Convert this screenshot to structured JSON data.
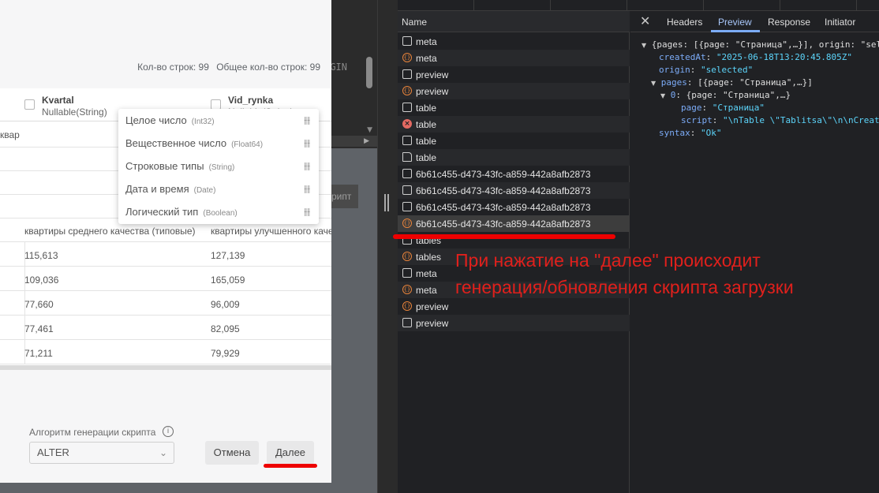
{
  "dialog": {
    "row_count_label": "Кол-во строк: 99",
    "total_row_count_label": "Общее кол-во строк: 99",
    "columns": [
      {
        "name": "Kvartal",
        "type": "Nullable(String)"
      },
      {
        "name": "Vid_rynka",
        "type": "Nullable(String)"
      }
    ],
    "row1_fragment": "квар",
    "row5": {
      "c1": "квартиры среднего качества (типовые)",
      "c2": "квартиры улучшенного каче"
    },
    "rows": [
      {
        "c1": "115,613",
        "c2": "127,139"
      },
      {
        "c1": "109,036",
        "c2": "165,059"
      },
      {
        "c1": "77,660",
        "c2": "96,009"
      },
      {
        "c1": "77,461",
        "c2": "82,095"
      },
      {
        "c1": "71,211",
        "c2": "79,929"
      }
    ],
    "type_menu": [
      {
        "label": "Целое число",
        "sub": "(Int32)"
      },
      {
        "label": "Вещественное число",
        "sub": "(Float64)"
      },
      {
        "label": "Строковые типы",
        "sub": "(String)"
      },
      {
        "label": "Дата и время",
        "sub": "(Date)"
      },
      {
        "label": "Логический тип",
        "sub": "(Boolean)"
      }
    ],
    "algo_label": "Алгоритм генерации скрипта",
    "algo_value": "ALTER",
    "cancel_label": "Отмена",
    "next_label": "Далее",
    "bg_script_fragment": "рипт",
    "bg_ign_fragment": "GIN"
  },
  "devtools": {
    "name_header": "Name",
    "requests": [
      {
        "name": "meta",
        "icon": "doc"
      },
      {
        "name": "meta",
        "icon": "js"
      },
      {
        "name": "preview",
        "icon": "doc"
      },
      {
        "name": "preview",
        "icon": "js"
      },
      {
        "name": "table",
        "icon": "doc"
      },
      {
        "name": "table",
        "icon": "error"
      },
      {
        "name": "table",
        "icon": "doc"
      },
      {
        "name": "table",
        "icon": "file"
      },
      {
        "name": "6b61c455-d473-43fc-a859-442a8afb2873",
        "icon": "doc"
      },
      {
        "name": "6b61c455-d473-43fc-a859-442a8afb2873",
        "icon": "doc"
      },
      {
        "name": "6b61c455-d473-43fc-a859-442a8afb2873",
        "icon": "doc"
      },
      {
        "name": "6b61c455-d473-43fc-a859-442a8afb2873",
        "icon": "js"
      },
      {
        "name": "tables",
        "icon": "doc"
      },
      {
        "name": "tables",
        "icon": "js"
      },
      {
        "name": "meta",
        "icon": "doc"
      },
      {
        "name": "meta",
        "icon": "js"
      },
      {
        "name": "preview",
        "icon": "js"
      },
      {
        "name": "preview",
        "icon": "doc"
      }
    ],
    "tabs": {
      "headers": "Headers",
      "preview": "Preview",
      "response": "Response",
      "initiator": "Initiator"
    },
    "preview": {
      "line1": "{pages: [{page: \"Страница\",…}], origin: \"sel",
      "createdAt_key": "createdAt",
      "createdAt_val": "\"2025-06-18T13:20:45.805Z\"",
      "origin_key": "origin",
      "origin_val": "\"selected\"",
      "pages_key": "pages",
      "pages_val": "[{page: \"Страница\",…}]",
      "item0_key": "0",
      "item0_val": "{page: \"Страница\",…}",
      "page_key": "page",
      "page_val": "\"Страница\"",
      "script_key": "script",
      "script_val": "\"\\nTable \\\"Tablitsa\\\"\\n\\nCreate",
      "syntax_key": "syntax",
      "syntax_val": "\"Ok\""
    }
  },
  "annotation": {
    "text": "При нажатие на \"далее\" происходит генерация/обновления скрипта загрузки",
    "color": "#e0201c"
  }
}
